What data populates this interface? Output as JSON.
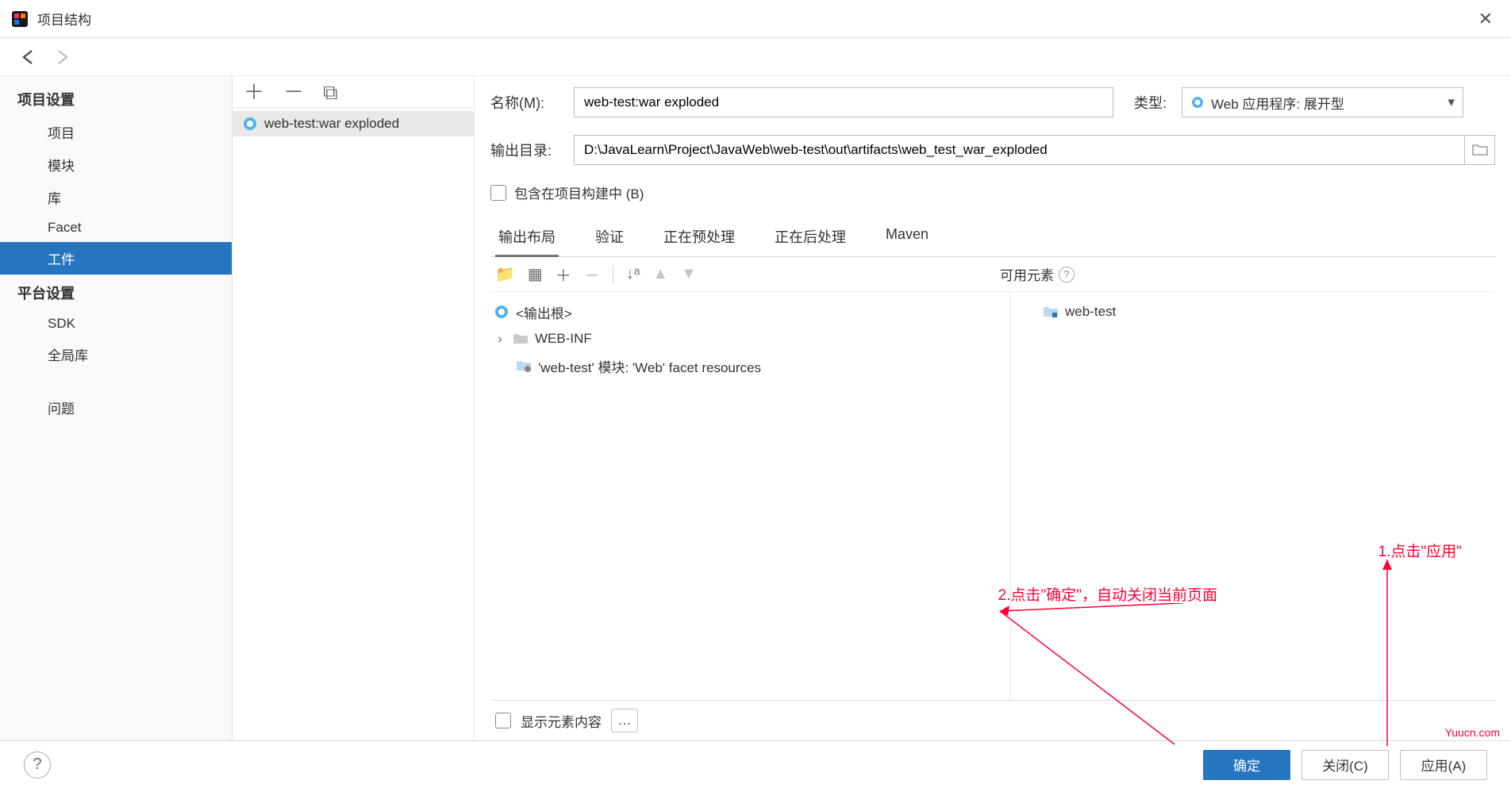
{
  "window": {
    "title": "项目结构"
  },
  "sidebar": {
    "sections": [
      {
        "header": "项目设置",
        "items": [
          "项目",
          "模块",
          "库",
          "Facet",
          "工件"
        ]
      },
      {
        "header": "平台设置",
        "items": [
          "SDK",
          "全局库"
        ]
      }
    ],
    "extra": "问题",
    "selected": "工件"
  },
  "middle": {
    "items": [
      "web-test:war exploded"
    ]
  },
  "form": {
    "name_label": "名称(M):",
    "name_value": "web-test:war exploded",
    "type_label": "类型:",
    "type_value": "Web 应用程序: 展开型",
    "out_label": "输出目录:",
    "out_value": "D:\\JavaLearn\\Project\\JavaWeb\\web-test\\out\\artifacts\\web_test_war_exploded",
    "include_label": "包含在项目构建中 (B)"
  },
  "tabs": [
    "输出布局",
    "验证",
    "正在预处理",
    "正在后处理",
    "Maven"
  ],
  "available_label": "可用元素",
  "tree_left": {
    "root": "<输出根>",
    "webinf": "WEB-INF",
    "facet": "'web-test' 模块: 'Web' facet resources"
  },
  "tree_right": {
    "root": "web-test"
  },
  "show_label": "显示元素内容",
  "footer": {
    "ok": "确定",
    "close": "关闭(C)",
    "apply": "应用(A)"
  },
  "anno": {
    "a1": "1.点击\"应用\"",
    "a2": "2.点击\"确定\"，自动关闭当前页面"
  },
  "watermark": "Yuucn.com"
}
